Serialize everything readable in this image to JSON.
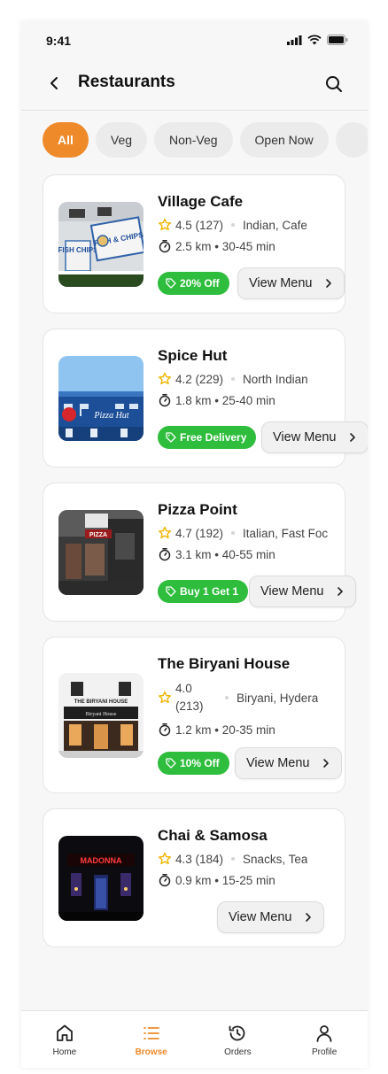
{
  "status_bar": {
    "time": "9:41"
  },
  "header": {
    "title": "Restaurants"
  },
  "filters": [
    "All",
    "Veg",
    "Non-Veg",
    "Open Now"
  ],
  "restaurants": [
    {
      "name": "Village Cafe",
      "rating": "4.5 (127)",
      "cuisine": "Indian, Cafe",
      "meta": "2.5 km • 30-45 min",
      "offer": "20% Off",
      "action": "View Menu"
    },
    {
      "name": "Spice Hut",
      "rating": "4.2 (229)",
      "cuisine": "North Indian",
      "meta": "1.8 km • 25-40 min",
      "offer": "Free Delivery",
      "action": "View Menu"
    },
    {
      "name": "Pizza Point",
      "rating": "4.7 (192)",
      "cuisine": "Italian, Fast Foc",
      "meta": "3.1 km • 40-55 min",
      "offer": "Buy 1 Get 1",
      "action": "View Menu"
    },
    {
      "name": "The Biryani House",
      "rating_line1": "4.0",
      "rating_line2": "(213)",
      "cuisine": "Biryani, Hydera",
      "meta": "1.2 km • 20-35 min",
      "offer": "10% Off",
      "action": "View Menu"
    },
    {
      "name": "Chai & Samosa",
      "rating": "4.3 (184)",
      "cuisine": "Snacks, Tea",
      "meta": "0.9 km • 15-25 min",
      "action": "View Menu"
    }
  ],
  "image_signs": {
    "fish_chips": "FISH & CHIPS",
    "fish_chips_small": "FISH CHIPS",
    "pizza_hut": "Pizza Hut",
    "pizza_sign": "PIZZA",
    "biryani_top": "THE BIRYANI HOUSE",
    "biryani_board": "Biryani House",
    "madonna": "MADONNA"
  },
  "bottom_nav": [
    {
      "label": "Home",
      "icon": "home-icon"
    },
    {
      "label": "Browse",
      "icon": "list-icon",
      "active": true
    },
    {
      "label": "Orders",
      "icon": "history-icon"
    },
    {
      "label": "Profile",
      "icon": "user-icon"
    }
  ],
  "colors": {
    "accent": "#ef8a2a",
    "offer_green": "#2ebd3c",
    "star": "#f0b400"
  }
}
